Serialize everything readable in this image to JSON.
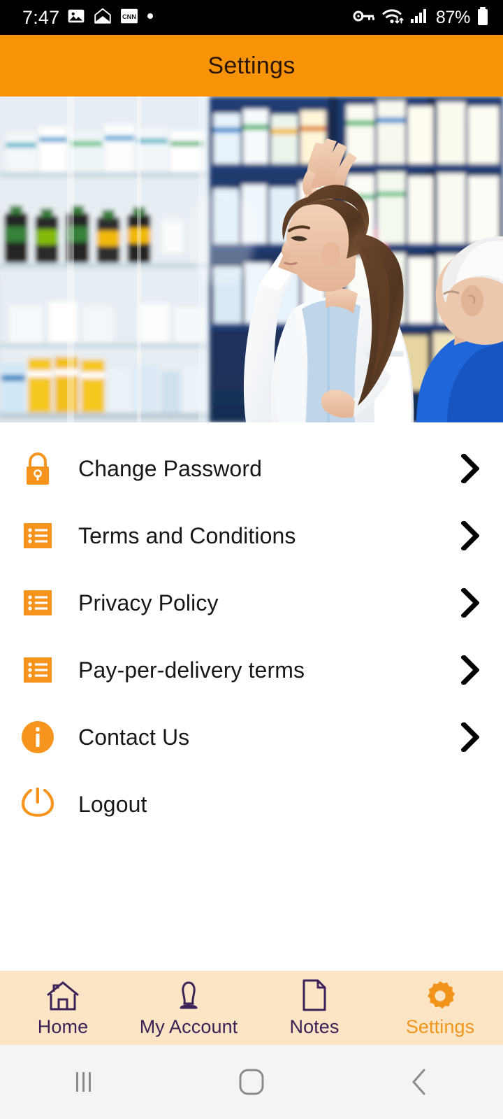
{
  "status_bar": {
    "time": "7:47",
    "battery_percent": "87%",
    "left_icons": [
      "photo-icon",
      "envelope-icon",
      "cnn-app-icon",
      "dot-indicator-icon"
    ],
    "right_icons": [
      "vpn-key-icon",
      "wifi-icon",
      "cellular-signal-icon",
      "battery-icon"
    ]
  },
  "app_bar": {
    "title": "Settings",
    "background_color": "#F79306",
    "title_color": "#2b1505"
  },
  "hero": {
    "alt": "Pharmacist reaching for medicine on shelf while serving an elderly customer",
    "name": "pharmacy-hero-image"
  },
  "menu": {
    "items": [
      {
        "label": "Change Password",
        "icon": "lock-icon",
        "has_chevron": true
      },
      {
        "label": "Terms and Conditions",
        "icon": "list-icon",
        "has_chevron": true
      },
      {
        "label": "Privacy Policy",
        "icon": "list-icon",
        "has_chevron": true
      },
      {
        "label": "Pay-per-delivery terms",
        "icon": "list-icon",
        "has_chevron": true
      },
      {
        "label": "Contact Us",
        "icon": "info-circle-icon",
        "has_chevron": true
      },
      {
        "label": "Logout",
        "icon": "power-icon",
        "has_chevron": false
      }
    ]
  },
  "tab_bar": {
    "background_color": "#FCE5C4",
    "inactive_color": "#3b2259",
    "active_color": "#F0961C",
    "items": [
      {
        "label": "Home",
        "icon": "house-icon",
        "active": false
      },
      {
        "label": "My Account",
        "icon": "person-icon",
        "active": false
      },
      {
        "label": "Notes",
        "icon": "document-icon",
        "active": false
      },
      {
        "label": "Settings",
        "icon": "gear-icon",
        "active": true
      }
    ]
  },
  "system_nav": {
    "buttons": [
      "recents-icon",
      "home-square-icon",
      "back-chevron-icon"
    ]
  },
  "theme": {
    "orange": "#F79306",
    "icon_orange": "#F7941D",
    "peach": "#FCE5C4",
    "purple": "#3b2259"
  }
}
